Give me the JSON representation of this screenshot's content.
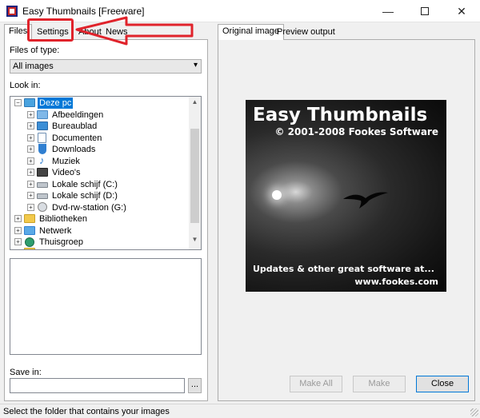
{
  "window": {
    "title": "Easy Thumbnails [Freeware]",
    "min_glyph": "—",
    "close_glyph": "✕"
  },
  "left_tabs": {
    "files": "Files",
    "settings": "Settings",
    "about": "About",
    "news": "News"
  },
  "files_panel": {
    "files_of_type_label": "Files of type:",
    "files_of_type_value": "All images",
    "look_in_label": "Look in:",
    "tree": [
      {
        "label": "Deze pc",
        "selected": true
      },
      {
        "label": "Afbeeldingen"
      },
      {
        "label": "Bureaublad"
      },
      {
        "label": "Documenten"
      },
      {
        "label": "Downloads"
      },
      {
        "label": "Muziek"
      },
      {
        "label": "Video's"
      },
      {
        "label": "Lokale schijf (C:)"
      },
      {
        "label": "Lokale schijf (D:)"
      },
      {
        "label": "Dvd-rw-station (G:)"
      },
      {
        "label": "Bibliotheken"
      },
      {
        "label": "Netwerk"
      },
      {
        "label": "Thuisgroep"
      },
      {
        "label": "..."
      }
    ],
    "save_in_label": "Save in:",
    "save_in_value": "",
    "browse_label": "..."
  },
  "right_tabs": {
    "original": "Original image",
    "preview": "Preview output"
  },
  "preview_image": {
    "title": "Easy Thumbnails",
    "subtitle": "© 2001-2008 Fookes Software",
    "footer_line1": "Updates & other great software at...",
    "footer_line2": "www.fookes.com"
  },
  "buttons": {
    "make_all": "Make All",
    "make": "Make",
    "close": "Close"
  },
  "status": {
    "text": "Select the folder that contains your images"
  },
  "colors": {
    "selection": "#0078d7",
    "annotation": "#e0232b"
  }
}
